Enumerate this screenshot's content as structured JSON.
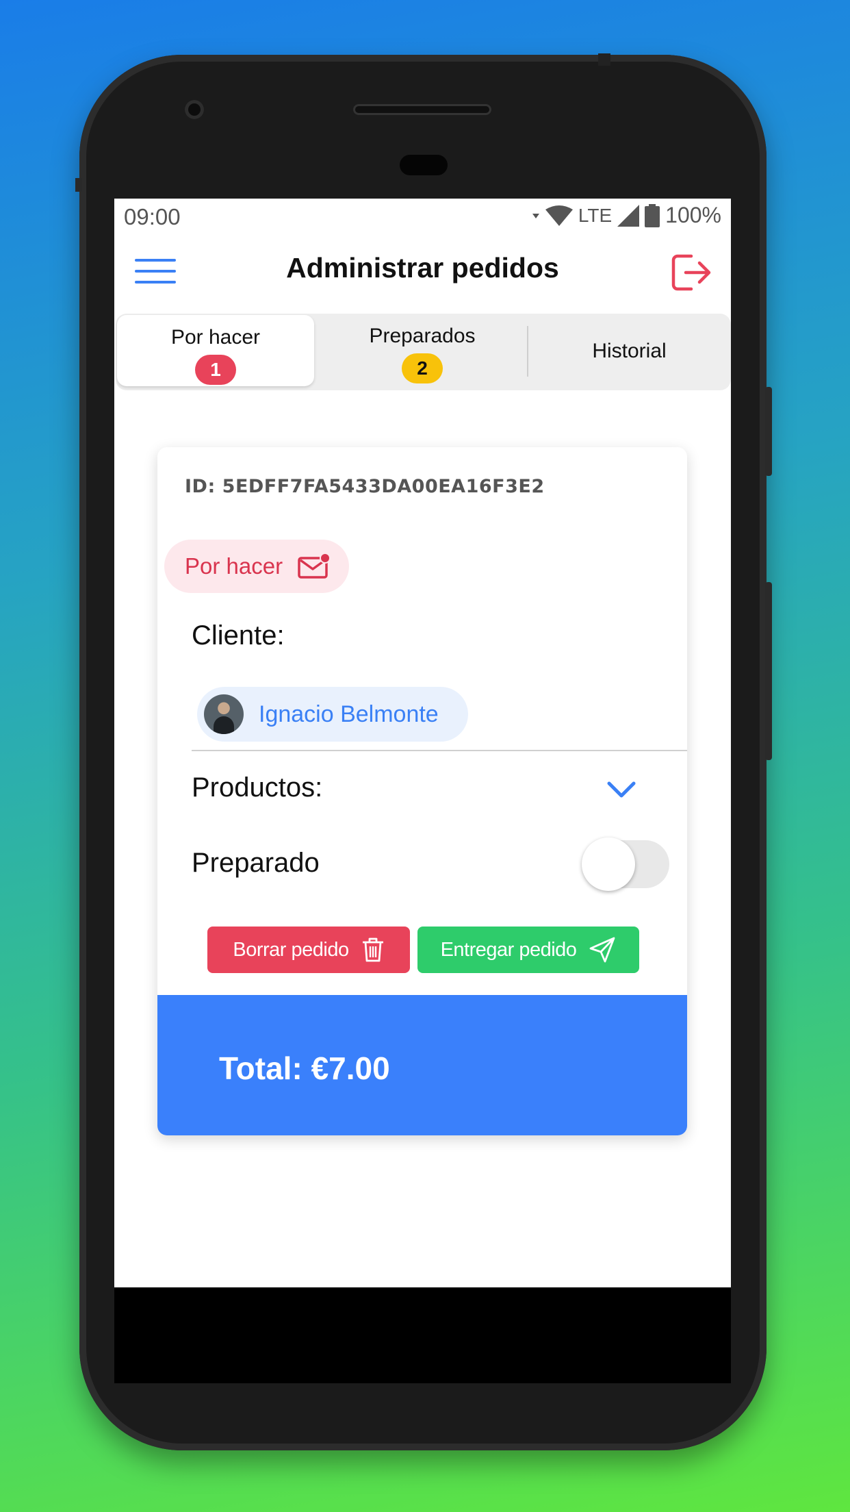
{
  "status_bar": {
    "time": "09:00",
    "network": "LTE",
    "battery": "100%"
  },
  "header": {
    "title": "Administrar pedidos",
    "menu_icon": "hamburger-icon",
    "logout_icon": "logout-icon"
  },
  "tabs": [
    {
      "label": "Por hacer",
      "badge": "1",
      "active": true
    },
    {
      "label": "Preparados",
      "badge": "2",
      "active": false
    },
    {
      "label": "Historial",
      "active": false
    }
  ],
  "order": {
    "id": "ID: 5EDFF7FA5433DA00EA16F3E2",
    "status_label": "Por hacer",
    "cliente_label": "Cliente:",
    "client_name": "Ignacio Belmonte",
    "productos_label": "Productos:",
    "preparado_label": "Preparado",
    "preparado_on": false,
    "delete_label": "Borrar pedido",
    "deliver_label": "Entregar pedido",
    "total": "Total: €7.00"
  },
  "colors": {
    "primary": "#3a80fb",
    "danger": "#e8435a",
    "success": "#2ecc6b",
    "warning": "#f8c20a"
  }
}
